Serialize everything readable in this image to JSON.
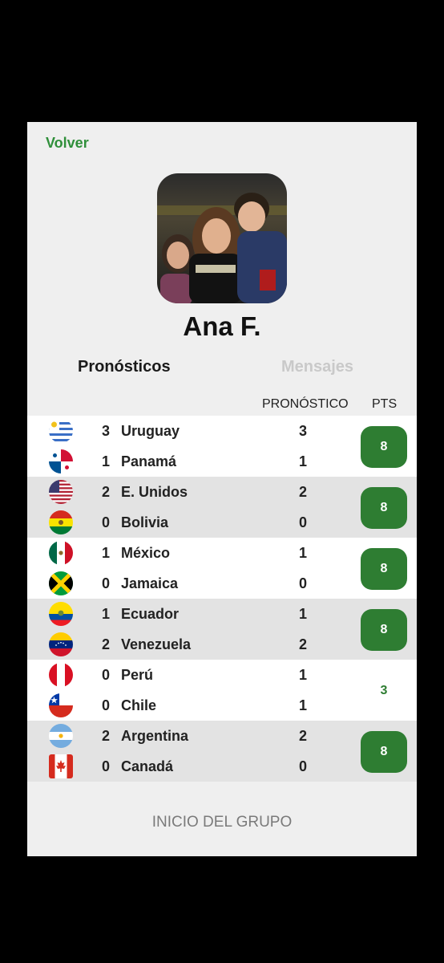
{
  "nav": {
    "back_label": "Volver"
  },
  "profile": {
    "name": "Ana F."
  },
  "tabs": [
    {
      "label": "Pronósticos",
      "active": true
    },
    {
      "label": "Mensajes",
      "active": false
    }
  ],
  "columns": {
    "prediction": "PRONÓSTICO",
    "points": "PTS"
  },
  "matches": [
    {
      "teams": [
        {
          "flag": "uruguay-flag",
          "score": "3",
          "name": "Uruguay",
          "pred": "3"
        },
        {
          "flag": "panama-flag",
          "score": "1",
          "name": "Panamá",
          "pred": "1"
        }
      ],
      "pts": "8",
      "badge": true
    },
    {
      "teams": [
        {
          "flag": "usa-flag",
          "score": "2",
          "name": "E. Unidos",
          "pred": "2"
        },
        {
          "flag": "bolivia-flag",
          "score": "0",
          "name": "Bolivia",
          "pred": "0"
        }
      ],
      "pts": "8",
      "badge": true
    },
    {
      "teams": [
        {
          "flag": "mexico-flag",
          "score": "1",
          "name": "México",
          "pred": "1"
        },
        {
          "flag": "jamaica-flag",
          "score": "0",
          "name": "Jamaica",
          "pred": "0"
        }
      ],
      "pts": "8",
      "badge": true
    },
    {
      "teams": [
        {
          "flag": "ecuador-flag",
          "score": "1",
          "name": "Ecuador",
          "pred": "1"
        },
        {
          "flag": "venezuela-flag",
          "score": "2",
          "name": "Venezuela",
          "pred": "2"
        }
      ],
      "pts": "8",
      "badge": true
    },
    {
      "teams": [
        {
          "flag": "peru-flag",
          "score": "0",
          "name": "Perú",
          "pred": "1"
        },
        {
          "flag": "chile-flag",
          "score": "0",
          "name": "Chile",
          "pred": "1"
        }
      ],
      "pts": "3",
      "badge": false
    },
    {
      "teams": [
        {
          "flag": "argentina-flag",
          "score": "2",
          "name": "Argentina",
          "pred": "2"
        },
        {
          "flag": "canada-flag",
          "score": "0",
          "name": "Canadá",
          "pred": "0"
        }
      ],
      "pts": "8",
      "badge": true
    }
  ],
  "footer": {
    "label": "INICIO DEL GRUPO"
  },
  "colors": {
    "accent": "#2e7d32",
    "link": "#2f8f3a"
  }
}
